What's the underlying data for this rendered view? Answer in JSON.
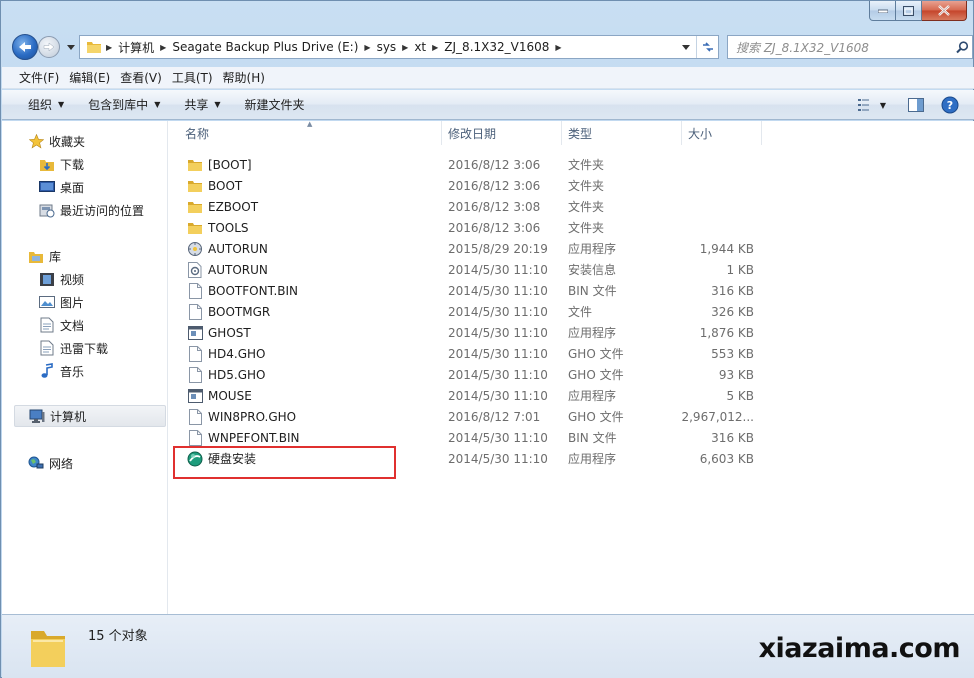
{
  "window": {
    "caption_buttons": [
      "minimize",
      "maximize",
      "close"
    ]
  },
  "address_bar": {
    "breadcrumbs": [
      "计算机",
      "Seagate Backup Plus Drive (E:)",
      "sys",
      "xt",
      "ZJ_8.1X32_V1608"
    ]
  },
  "search": {
    "placeholder": "搜索 ZJ_8.1X32_V1608"
  },
  "menu": [
    "文件(F)",
    "编辑(E)",
    "查看(V)",
    "工具(T)",
    "帮助(H)"
  ],
  "commands": [
    "组织",
    "包含到库中",
    "共享",
    "新建文件夹"
  ],
  "sidebar": {
    "favorites": {
      "label": "收藏夹",
      "items": [
        "下载",
        "桌面",
        "最近访问的位置"
      ]
    },
    "libraries": {
      "label": "库",
      "items": [
        "视频",
        "图片",
        "文档",
        "迅雷下载",
        "音乐"
      ]
    },
    "computer": "计算机",
    "network": "网络"
  },
  "columns": [
    "名称",
    "修改日期",
    "类型",
    "大小"
  ],
  "files": [
    {
      "name": "[BOOT]",
      "date": "2016/8/12 3:06",
      "type": "文件夹",
      "size": "",
      "icon": "folder-icon"
    },
    {
      "name": "BOOT",
      "date": "2016/8/12 3:06",
      "type": "文件夹",
      "size": "",
      "icon": "folder-icon"
    },
    {
      "name": "EZBOOT",
      "date": "2016/8/12 3:08",
      "type": "文件夹",
      "size": "",
      "icon": "folder-icon"
    },
    {
      "name": "TOOLS",
      "date": "2016/8/12 3:06",
      "type": "文件夹",
      "size": "",
      "icon": "folder-icon"
    },
    {
      "name": "AUTORUN",
      "date": "2015/8/29 20:19",
      "type": "应用程序",
      "size": "1,944 KB",
      "icon": "autorun-app-icon"
    },
    {
      "name": "AUTORUN",
      "date": "2014/5/30 11:10",
      "type": "安装信息",
      "size": "1 KB",
      "icon": "setup-info-icon"
    },
    {
      "name": "BOOTFONT.BIN",
      "date": "2014/5/30 11:10",
      "type": "BIN 文件",
      "size": "316 KB",
      "icon": "file-icon"
    },
    {
      "name": "BOOTMGR",
      "date": "2014/5/30 11:10",
      "type": "文件",
      "size": "326 KB",
      "icon": "file-icon"
    },
    {
      "name": "GHOST",
      "date": "2014/5/30 11:10",
      "type": "应用程序",
      "size": "1,876 KB",
      "icon": "app-window-icon"
    },
    {
      "name": "HD4.GHO",
      "date": "2014/5/30 11:10",
      "type": "GHO 文件",
      "size": "553 KB",
      "icon": "file-icon"
    },
    {
      "name": "HD5.GHO",
      "date": "2014/5/30 11:10",
      "type": "GHO 文件",
      "size": "93 KB",
      "icon": "file-icon"
    },
    {
      "name": "MOUSE",
      "date": "2014/5/30 11:10",
      "type": "应用程序",
      "size": "5 KB",
      "icon": "app-window-icon"
    },
    {
      "name": "WIN8PRO.GHO",
      "date": "2016/8/12 7:01",
      "type": "GHO 文件",
      "size": "2,967,012...",
      "icon": "file-icon"
    },
    {
      "name": "WNPEFONT.BIN",
      "date": "2014/5/30 11:10",
      "type": "BIN 文件",
      "size": "316 KB",
      "icon": "file-icon"
    },
    {
      "name": "硬盘安装",
      "date": "2014/5/30 11:10",
      "type": "应用程序",
      "size": "6,603 KB",
      "icon": "installer-globe-icon"
    }
  ],
  "status": {
    "count_text": "15 个对象"
  },
  "watermark": "xiazaima.com",
  "colors": {
    "highlight_border": "#e0302f",
    "frame": "#c9dff3",
    "folder": "#f1c94a"
  }
}
